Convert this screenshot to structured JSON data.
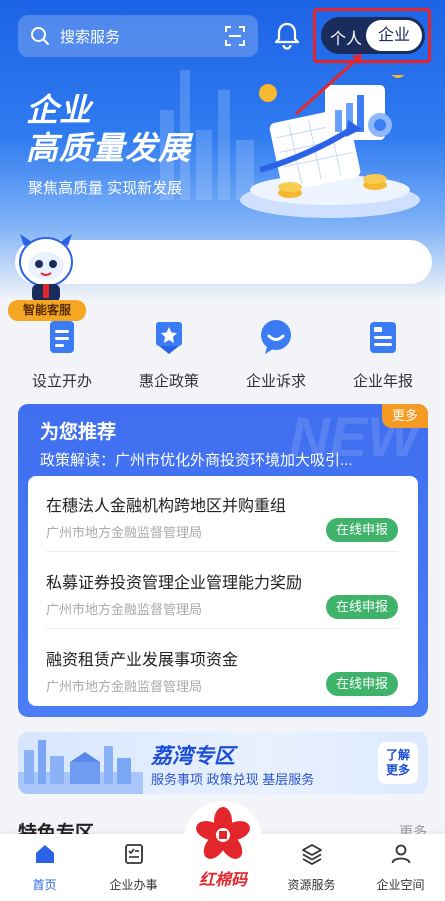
{
  "header": {
    "search_placeholder": "搜索服务",
    "mode_personal": "个人",
    "mode_enterprise": "企业"
  },
  "hero": {
    "slogan_line1": "企业",
    "slogan_line2": "高质量发展",
    "slogan_sub": "聚焦高质量 实现新发展"
  },
  "assistant": {
    "tag": "智能客服"
  },
  "quick_actions": [
    {
      "label": "设立开办"
    },
    {
      "label": "惠企政策"
    },
    {
      "label": "企业诉求"
    },
    {
      "label": "企业年报"
    }
  ],
  "recommend": {
    "title": "为您推荐",
    "more": "更多",
    "watermark": "NEW",
    "policy": "政策解读：广州市优化外商投资环境加大吸引...",
    "items": [
      {
        "name": "在穗法人金融机构跨地区并购重组",
        "org": "广州市地方金融监督管理局",
        "action": "在线申报"
      },
      {
        "name": "私募证券投资管理企业管理能力奖励",
        "org": "广州市地方金融监督管理局",
        "action": "在线申报"
      },
      {
        "name": "融资租赁产业发展事项资金",
        "org": "广州市地方金融监督管理局",
        "action": "在线申报"
      }
    ]
  },
  "banner": {
    "title": "荔湾专区",
    "subtitle": "服务事项  政策兑现  基层服务",
    "cta_line1": "了解",
    "cta_line2": "更多"
  },
  "section": {
    "title": "特色专区",
    "more": "更多"
  },
  "tabbar": {
    "items": [
      {
        "label": "首页"
      },
      {
        "label": "企业办事"
      },
      {
        "label": "红棉码"
      },
      {
        "label": "资源服务"
      },
      {
        "label": "企业空间"
      }
    ]
  },
  "colors": {
    "primary": "#2a63e6",
    "highlight_box": "#e6252b",
    "apply_button": "#3fb36a",
    "more_badge": "#f59a23",
    "brand_red": "#e3262c"
  }
}
